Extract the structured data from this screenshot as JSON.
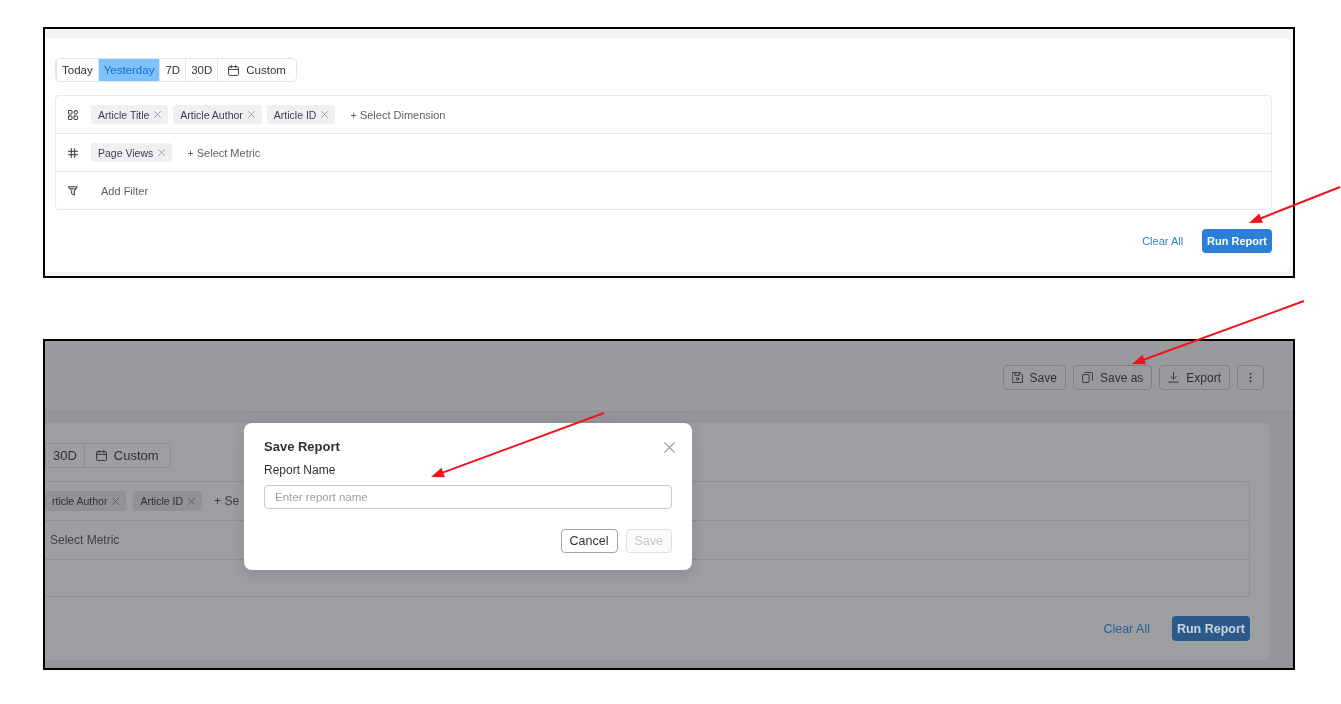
{
  "screenshot_1": {
    "date_range": [
      {
        "label": "Today",
        "kind": "preset",
        "selected": false
      },
      {
        "label": "Yesterday",
        "kind": "preset",
        "selected": true
      },
      {
        "label": "7D",
        "kind": "preset",
        "selected": false
      },
      {
        "label": "30D",
        "kind": "preset",
        "selected": false
      },
      {
        "label": "Custom",
        "kind": "custom",
        "selected": false
      }
    ],
    "query": [
      {
        "kind": "dimension",
        "tags": [
          "Article Title",
          "Article Author",
          "Article ID"
        ],
        "add": "+ Select Dimension"
      },
      {
        "kind": "metric",
        "tags": [
          "Page Views"
        ],
        "add": "+ Select Metric"
      },
      {
        "kind": "filter",
        "add": "Add Filter"
      }
    ],
    "actions": {
      "clear": "Clear All",
      "run": "Run Report"
    }
  },
  "screenshot_2": {
    "toolbar": [
      {
        "kind": "save",
        "label": "Save"
      },
      {
        "kind": "copy",
        "label": "Save as"
      },
      {
        "kind": "export",
        "label": "Export"
      },
      {
        "kind": "more"
      }
    ],
    "date_range": [
      {
        "label": "30D",
        "kind": "preset",
        "selected": false
      },
      {
        "label": "Custom",
        "kind": "custom",
        "selected": false
      }
    ],
    "query": [
      {
        "tags": [
          "rticle Author",
          "Article ID"
        ],
        "add": "+ Se"
      },
      {
        "add": "Select Metric"
      }
    ],
    "actions": {
      "clear": "Clear All",
      "run": "Run Report"
    },
    "dialog": {
      "title": "Save Report",
      "field_label": "Report Name",
      "placeholder": "Enter report name",
      "buttons": [
        {
          "label": "Cancel",
          "disabled": false
        },
        {
          "label": "Save",
          "disabled": true
        }
      ]
    }
  }
}
